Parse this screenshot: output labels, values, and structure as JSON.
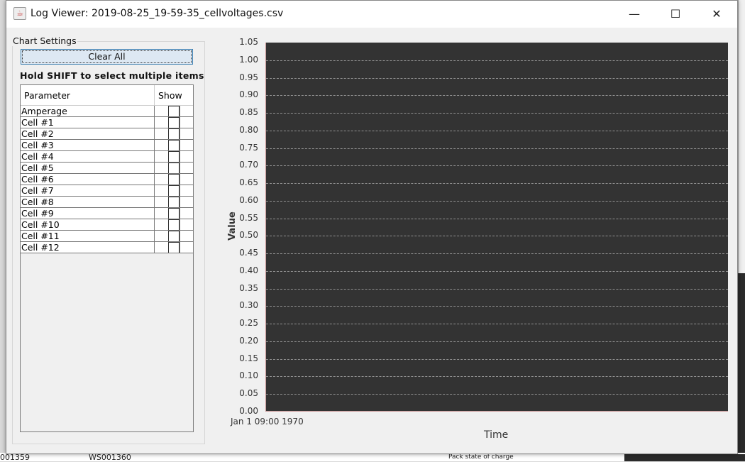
{
  "window": {
    "title": "Log Viewer: 2019-08-25_19-59-35_cellvoltages.csv",
    "minimize": "—",
    "maximize": "☐",
    "close": "✕",
    "icon": "java-icon"
  },
  "settings": {
    "group_label": "Chart Settings",
    "clear_all": "Clear All",
    "hint": "Hold SHIFT to select multiple items",
    "columns": [
      "Parameter",
      "Show"
    ],
    "rows": [
      {
        "name": "Amperage",
        "show": false
      },
      {
        "name": "Cell #1",
        "show": false
      },
      {
        "name": "Cell #2",
        "show": false
      },
      {
        "name": "Cell #3",
        "show": false
      },
      {
        "name": "Cell #4",
        "show": false
      },
      {
        "name": "Cell #5",
        "show": false
      },
      {
        "name": "Cell #6",
        "show": false
      },
      {
        "name": "Cell #7",
        "show": false
      },
      {
        "name": "Cell #8",
        "show": false
      },
      {
        "name": "Cell #9",
        "show": false
      },
      {
        "name": "Cell #10",
        "show": false
      },
      {
        "name": "Cell #11",
        "show": false
      },
      {
        "name": "Cell #12",
        "show": false
      }
    ]
  },
  "chart_data": {
    "type": "line",
    "series": [],
    "xlabel": "Time",
    "ylabel": "Value",
    "ylim": [
      0,
      1.05
    ],
    "yticks": [
      "1.05",
      "1.00",
      "0.95",
      "0.90",
      "0.85",
      "0.80",
      "0.75",
      "0.70",
      "0.65",
      "0.60",
      "0.55",
      "0.50",
      "0.45",
      "0.40",
      "0.35",
      "0.30",
      "0.25",
      "0.20",
      "0.15",
      "0.10",
      "0.05",
      "0.00"
    ],
    "xticks": [
      "Jan 1 09:00 1970"
    ],
    "grid": true,
    "background": "#333333"
  },
  "background_app": {
    "cells": [
      "001359",
      "WS001360",
      "Pack state of charge"
    ]
  }
}
